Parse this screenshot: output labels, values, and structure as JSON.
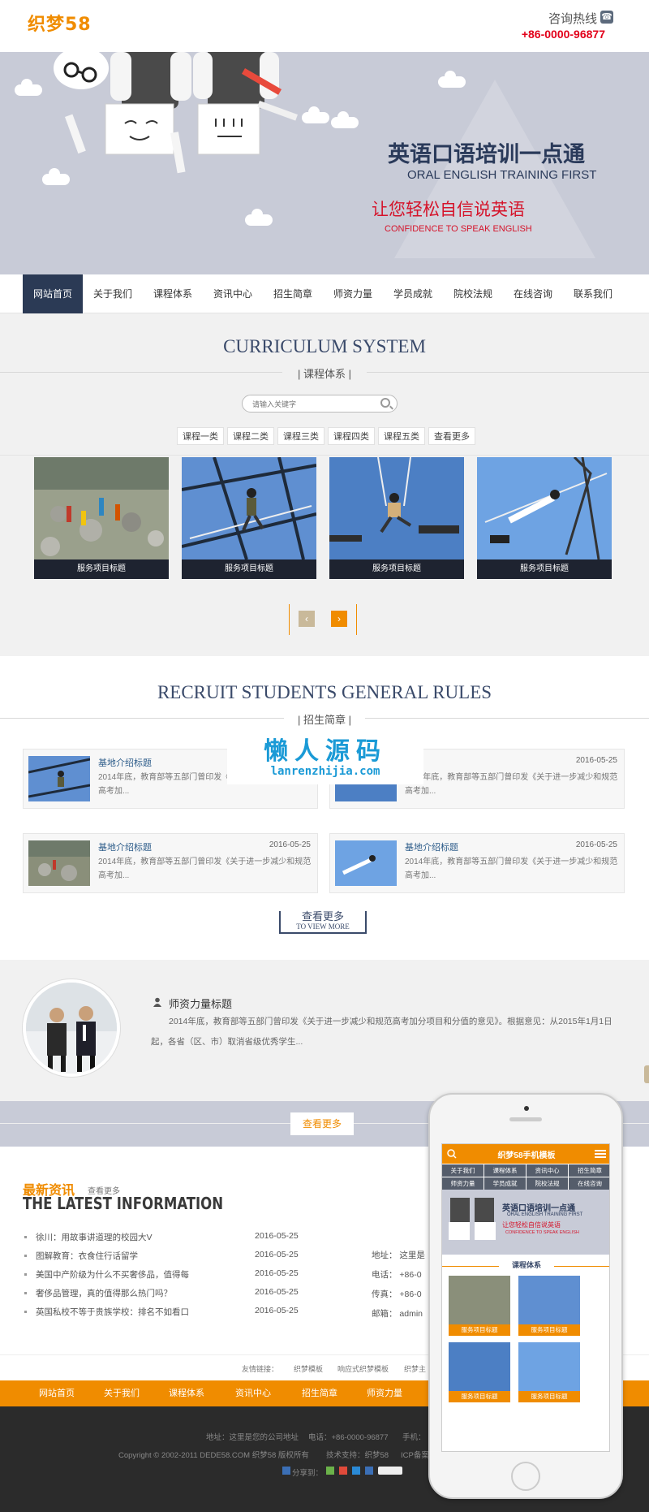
{
  "header": {
    "logo": "织梦58",
    "hotline_label": "咨询热线",
    "hotline_number": "+86-0000-96877",
    "phone_icon": "phone-icon"
  },
  "banner": {
    "title": "英语口语培训一点通",
    "subtitle": "ORAL ENGLISH TRAINING FIRST",
    "slogan": "让您轻松自信说英语",
    "slogan_en": "CONFIDENCE TO SPEAK ENGLISH"
  },
  "nav": {
    "items": [
      "网站首页",
      "关于我们",
      "课程体系",
      "资讯中心",
      "招生简章",
      "师资力量",
      "学员成就",
      "院校法规",
      "在线咨询",
      "联系我们"
    ],
    "active": "网站首页"
  },
  "curriculum": {
    "title": "CURRICULUM SYSTEM",
    "subtitle": "| 课程体系 |",
    "search_placeholder": "请输入关键字",
    "categories": [
      "课程一类",
      "课程二类",
      "课程三类",
      "课程四类",
      "课程五类",
      "查看更多"
    ],
    "cards": [
      "服务项目标题",
      "服务项目标题",
      "服务项目标题",
      "服务项目标题"
    ],
    "prev": "‹",
    "next": "›"
  },
  "recruit": {
    "title": "RECRUIT STUDENTS GENERAL RULES",
    "subtitle": "| 招生简章 |",
    "items": [
      {
        "title": "基地介绍标题",
        "date": "",
        "desc": "2014年底，教育部等五部门曾印发《关于进一步减少和规范高考加..."
      },
      {
        "title": "",
        "date": "2016-05-25",
        "desc": "2014年底，教育部等五部门曾印发《关于进一步减少和规范高考加..."
      },
      {
        "title": "基地介绍标题",
        "date": "2016-05-25",
        "desc": "2014年底，教育部等五部门曾印发《关于进一步减少和规范高考加..."
      },
      {
        "title": "基地介绍标题",
        "date": "2016-05-25",
        "desc": "2014年底，教育部等五部门曾印发《关于进一步减少和规范高考加..."
      }
    ],
    "view_more_cn": "查看更多",
    "view_more_en": "TO VIEW MORE"
  },
  "watermark": {
    "cn": "懒人源码",
    "en": "lanrenzhijia.com"
  },
  "teachers": {
    "title": "师资力量标题",
    "desc": "2014年底，教育部等五部门曾印发《关于进一步减少和规范高考加分项目和分值的意见》。根据意见：从2015年1月1日起，各省（区、市）取消省级优秀学生...",
    "more": "查看更多"
  },
  "news": {
    "title_cn": "最新资讯",
    "more": "查看更多",
    "title_en": "THE LATEST INFORMATION",
    "items": [
      {
        "title": "徐川：用故事讲道理的校园大V",
        "date": "2016-05-25"
      },
      {
        "title": "图解教育：衣食住行话留学",
        "date": "2016-05-25"
      },
      {
        "title": "美国中产阶级为什么不买奢侈品，值得每",
        "date": "2016-05-25"
      },
      {
        "title": "奢侈品管理，真的值得那么热门吗？",
        "date": "2016-05-25"
      },
      {
        "title": "英国私校不等于贵族学校：排名不如看口",
        "date": "2016-05-25"
      }
    ],
    "contact": [
      {
        "label": "地址：",
        "value": "这里是"
      },
      {
        "label": "电话：",
        "value": "+86-0"
      },
      {
        "label": "传真：",
        "value": "+86-0"
      },
      {
        "label": "邮箱：",
        "value": "admin"
      }
    ]
  },
  "links": {
    "label": "友情链接：",
    "items": [
      "织梦模板",
      "响应式织梦模板",
      "织梦主"
    ]
  },
  "bottom_nav": {
    "items": [
      "网站首页",
      "关于我们",
      "课程体系",
      "资讯中心",
      "招生简章",
      "师资力量"
    ]
  },
  "footer": {
    "address": "地址：这里是您的公司地址",
    "phone": "电话：+86-0000-96877",
    "mobile": "手机：",
    "copyright": "Copyright © 2002-2011 DEDE58.COM 织梦58 版权所有",
    "support": "技术支持：织梦58",
    "icp": "ICP备案",
    "share": "分享到："
  },
  "phone_mockup": {
    "title": "织梦58手机模板",
    "nav": [
      "关于我们",
      "课程体系",
      "资讯中心",
      "招生简章",
      "师资力量",
      "学员成就",
      "院校法规",
      "在线咨询"
    ],
    "banner_title": "英语口语培训一点通",
    "banner_subtitle": "ORAL ENGLISH TRAINING FIRST",
    "banner_slogan": "让您轻松自信说英语",
    "banner_slogan_en": "CONFIDENCE TO SPEAK ENGLISH",
    "section": "课程体系",
    "cards": [
      "服务项目标题",
      "服务项目标题",
      "服务项目标题",
      "服务项目标题"
    ]
  }
}
